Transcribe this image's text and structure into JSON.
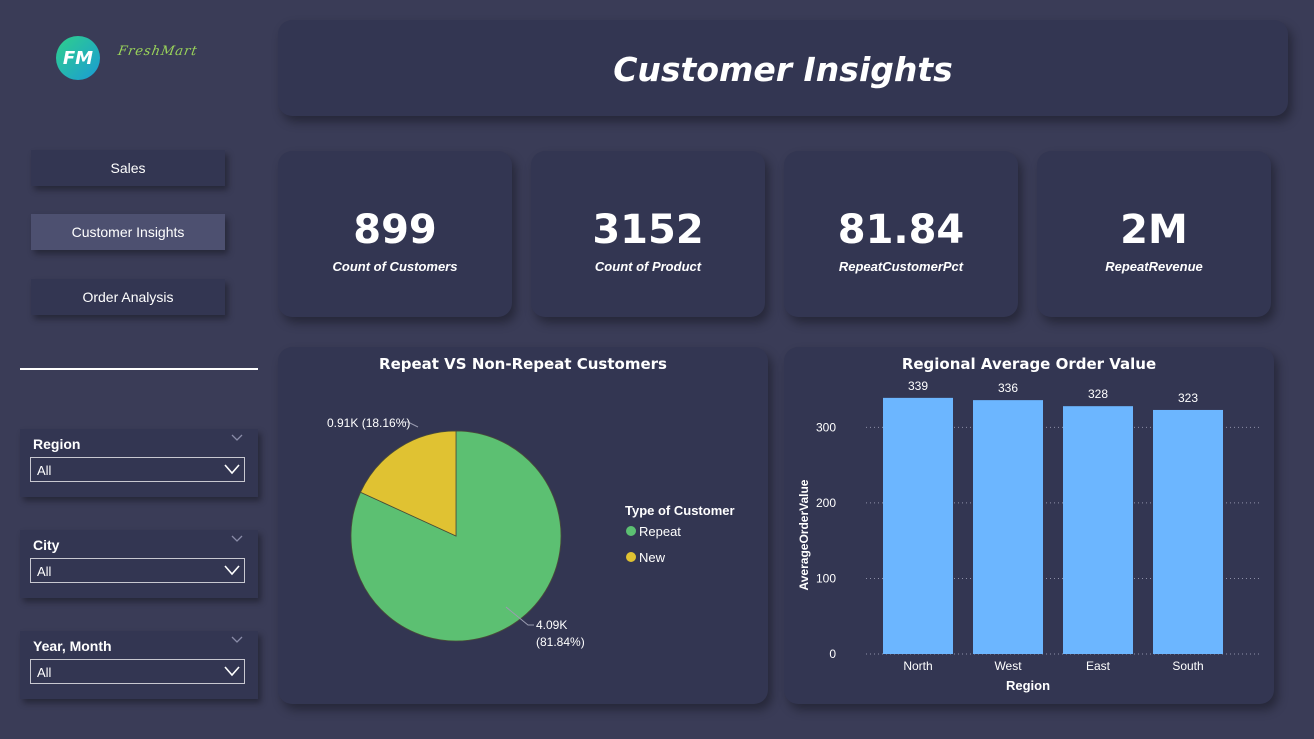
{
  "logo": {
    "badge_text": "FM",
    "brand_script": "FreshMart"
  },
  "header": {
    "title": "Customer Insights"
  },
  "nav": {
    "items": [
      {
        "label": "Sales",
        "active": false
      },
      {
        "label": "Customer Insights",
        "active": true
      },
      {
        "label": "Order Analysis",
        "active": false
      }
    ]
  },
  "filters": [
    {
      "label": "Region",
      "value": "All"
    },
    {
      "label": "City",
      "value": "All"
    },
    {
      "label": "Year, Month",
      "value": "All"
    }
  ],
  "kpis": [
    {
      "value": "899",
      "label": "Count of Customers"
    },
    {
      "value": "3152",
      "label": "Count of Product"
    },
    {
      "value": "81.84",
      "label": "RepeatCustomerPct"
    },
    {
      "value": "2M",
      "label": "RepeatRevenue"
    }
  ],
  "colors": {
    "repeat": "#5cc072",
    "new": "#e0c232",
    "bar": "#6cb6ff",
    "card": "#333652",
    "background": "#3a3c57"
  },
  "chart_data": [
    {
      "type": "pie",
      "title": "Repeat VS Non-Repeat Customers",
      "legend_title": "Type of Customer",
      "legend_position": "right",
      "slices": [
        {
          "name": "Repeat",
          "value": 4.09,
          "label_value": "4.09K",
          "label_pct": "(81.84%)",
          "percent": 81.84
        },
        {
          "name": "New",
          "value": 0.91,
          "label_value": "0.91K",
          "label_pct": "(18.16%)",
          "percent": 18.16
        }
      ]
    },
    {
      "type": "bar",
      "title": "Regional Average Order Value",
      "xlabel": "Region",
      "ylabel": "AverageOrderValue",
      "categories": [
        "North",
        "West",
        "East",
        "South"
      ],
      "values": [
        339,
        336,
        328,
        323
      ],
      "ylim": [
        0,
        360
      ],
      "yticks": [
        0,
        100,
        200,
        300
      ],
      "grid": true
    }
  ]
}
